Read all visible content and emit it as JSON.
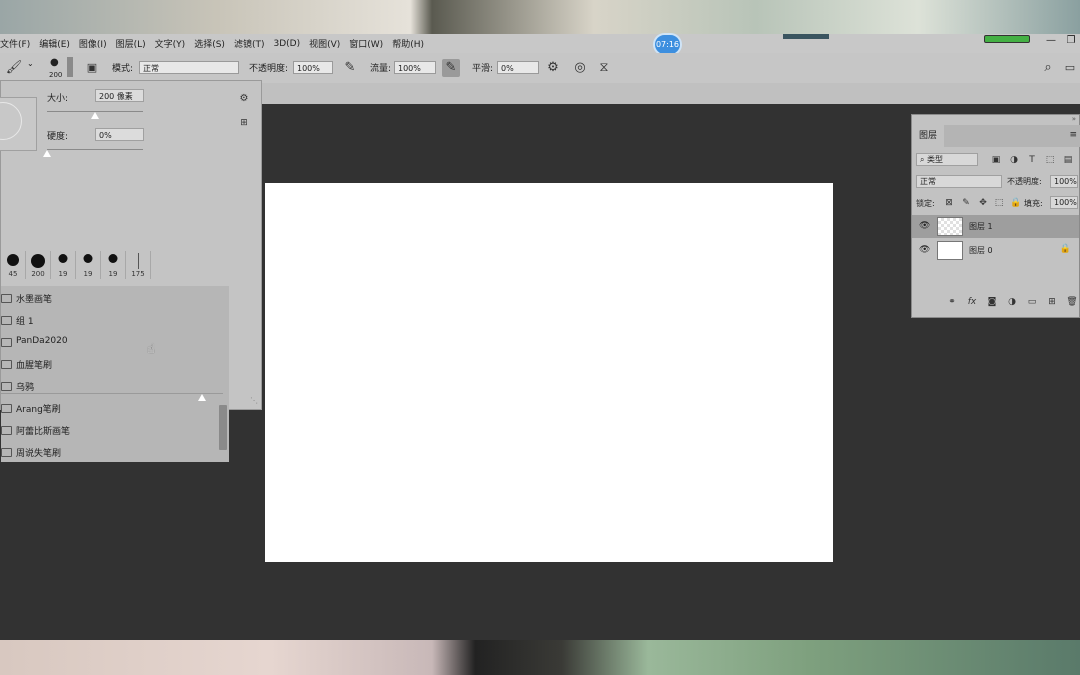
{
  "menu": [
    "文件(F)",
    "编辑(E)",
    "图像(I)",
    "图层(L)",
    "文字(Y)",
    "选择(S)",
    "滤镜(T)",
    "3D(D)",
    "视图(V)",
    "窗口(W)",
    "帮助(H)"
  ],
  "timer": "07:16",
  "window_buttons": {
    "minimize": "—",
    "restore": "❐"
  },
  "options": {
    "brush_size_small": "200",
    "mode_label": "模式:",
    "mode_value": "正常",
    "opacity_label": "不透明度:",
    "opacity_value": "100%",
    "flow_label": "流量:",
    "flow_value": "100%",
    "smooth_label": "平滑:",
    "smooth_value": "0%"
  },
  "brush_panel": {
    "size_label": "大小:",
    "size_value": "200 像素",
    "hardness_label": "硬度:",
    "hardness_value": "0%",
    "size_slider_fraction": 0.5,
    "hardness_slider_fraction": 0.0,
    "presets": [
      {
        "num": "45",
        "dot": 12
      },
      {
        "num": "200",
        "dot": 14
      },
      {
        "num": "19",
        "dot": 9
      },
      {
        "num": "19",
        "dot": 9
      },
      {
        "num": "19",
        "dot": 9
      },
      {
        "num": "175",
        "dot": 0
      }
    ],
    "folders": [
      "水墨画笔",
      "组 1",
      "PanDa2020",
      "血腥笔刷",
      "乌鸦",
      "Arang笔刷",
      "阿蕾比斯画笔",
      "周说失笔刷"
    ]
  },
  "layers": {
    "tab": "图层",
    "filter_value": "类型",
    "blend_value": "正常",
    "opacity_label": "不透明度:",
    "opacity_value": "100%",
    "lock_label": "锁定:",
    "fill_label": "填充:",
    "fill_value": "100%",
    "items": [
      {
        "name": "图层 1",
        "selected": true,
        "locked": false
      },
      {
        "name": "图层 0",
        "selected": false,
        "locked": true
      }
    ]
  }
}
